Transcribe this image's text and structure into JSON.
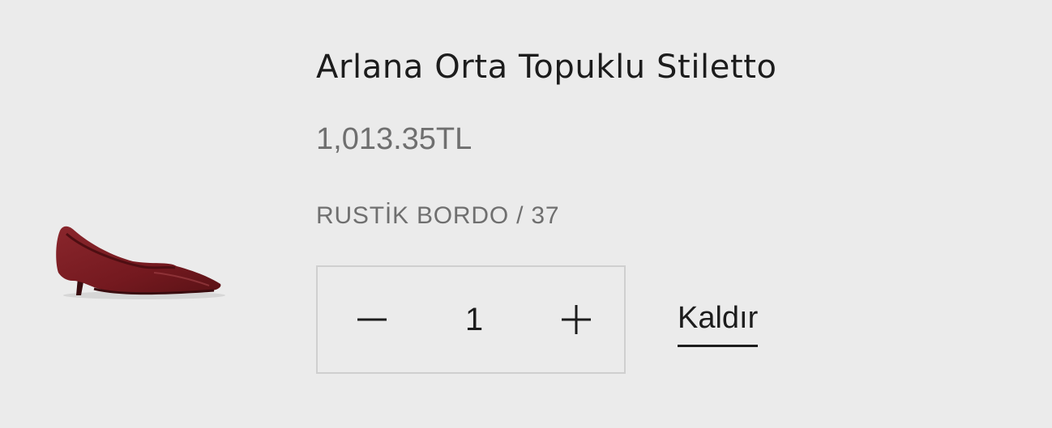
{
  "cart_item": {
    "product_name": "Arlana Orta Topuklu Stiletto",
    "price": "1,013.35TL",
    "variant": "RUSTİK BORDO / 37",
    "quantity": "1",
    "remove_label": "Kaldır",
    "image_icon": "burgundy-kitten-heel-pump-image",
    "decrease_icon": "minus-icon",
    "increase_icon": "plus-icon"
  },
  "colors": {
    "background": "#ebebeb",
    "text_primary": "#1c1c1c",
    "text_secondary": "#6f6f6f",
    "border": "#cfcfcf",
    "shoe": "#7a1f24"
  }
}
